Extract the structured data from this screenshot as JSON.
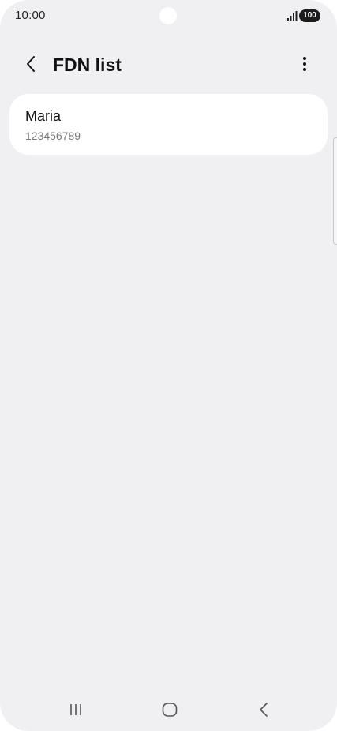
{
  "status_bar": {
    "time": "10:00",
    "battery": "100",
    "signal_icon": "signal-bars-icon"
  },
  "header": {
    "title": "FDN list",
    "back_icon": "chevron-left-icon",
    "more_icon": "more-vertical-icon"
  },
  "contacts": [
    {
      "name": "Maria",
      "number": "123456789"
    }
  ],
  "nav_bar": {
    "recents_icon": "recent-apps-icon",
    "home_icon": "home-icon",
    "back_icon": "back-icon"
  }
}
